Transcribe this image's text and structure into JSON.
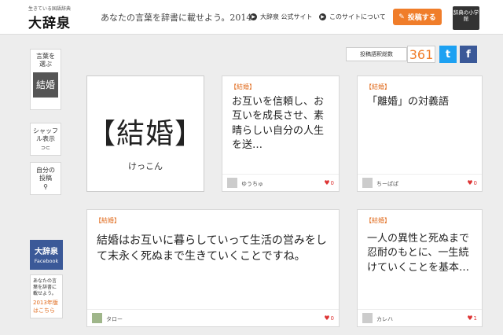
{
  "header": {
    "logo_small": "生きている国語辞典",
    "logo_main": "大辞泉",
    "tagline": "あなたの言葉を辞書に載せよう。2014",
    "link_official": "大辞泉 公式サイト",
    "link_about": "このサイトについて",
    "post_button": "投稿する",
    "shogakukan": "辞典の小学館"
  },
  "sidebar": {
    "choose_label": "言葉を選ぶ",
    "current_word": "結婚",
    "shuffle_label": "シャッフル表示",
    "shuffle_icon": "⊃⊂",
    "myposts_label": "自分の投稿",
    "facebook_title": "大辞泉",
    "facebook_sub": "Facebook",
    "old_text": "あなたの言葉を辞書に載せよう。",
    "old_link": "2013年版はこちら"
  },
  "counter": {
    "label": "投稿語釈総数",
    "value": "361",
    "twitter": "t",
    "facebook": "f"
  },
  "word": {
    "headword": "【結婚】",
    "reading": "けっこん"
  },
  "cards": [
    {
      "tag": "【結婚】",
      "text": "お互いを信頼し、お互いを成長させ、素晴らしい自分の人生を送…",
      "user": "ゆうちゅ",
      "likes": "0"
    },
    {
      "tag": "【結婚】",
      "text": "「離婚」の対義語",
      "user": "ちーぱぱ",
      "likes": "0"
    },
    {
      "tag": "【結婚】",
      "text": "結婚はお互いに暮らしていって生活の営みをして末永く死ぬまで生きていくことですね。",
      "user": "タロー",
      "likes": "0"
    },
    {
      "tag": "【結婚】",
      "text": "一人の異性と死ぬまで忍耐のもとに、一生続けていくことを基本…",
      "user": "カレハ",
      "likes": "1"
    }
  ],
  "colors": {
    "accent": "#f07d2a",
    "facebook": "#3b5998",
    "twitter": "#1da1f2"
  }
}
